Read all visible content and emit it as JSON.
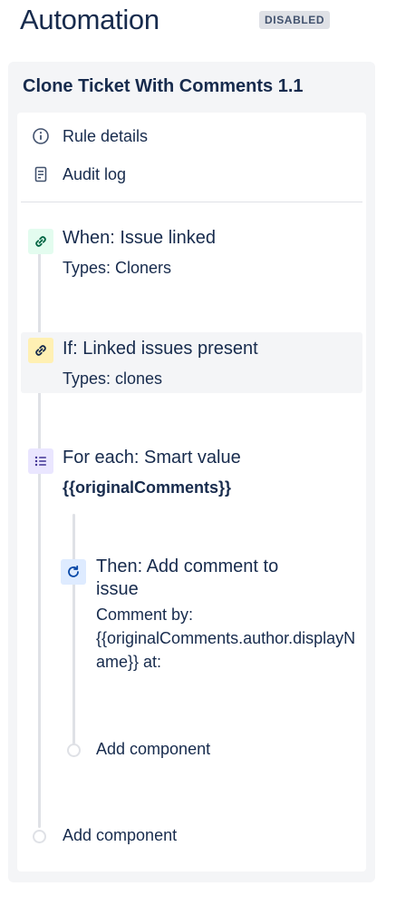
{
  "header": {
    "title": "Automation",
    "status_badge": "DISABLED"
  },
  "rule": {
    "name": "Clone Ticket With Comments 1.1",
    "menu": [
      {
        "label": "Rule details",
        "icon": "info-icon"
      },
      {
        "label": "Audit log",
        "icon": "document-icon"
      }
    ],
    "steps": [
      {
        "title": "When: Issue linked",
        "subtitle": "Types: Cloners",
        "icon": "link-icon",
        "color": "#e3fcef",
        "icon_color": "#006644"
      },
      {
        "title": "If: Linked issues present",
        "subtitle": "Types: clones",
        "icon": "link-icon",
        "color": "#fff0b3",
        "icon_color": "#172b4d"
      },
      {
        "title": "For each: Smart value",
        "subtitle": "{{originalComments}}",
        "icon": "list-icon",
        "color": "#eae6ff",
        "icon_color": "#403294"
      },
      {
        "title_line1": "Then: Add comment to",
        "title_line2": "issue",
        "subtitle_line1": "Comment by:",
        "subtitle_line2": "{{originalComments.author.displayN",
        "subtitle_line3": "ame}} at:",
        "icon": "refresh-icon",
        "color": "#deebff",
        "icon_color": "#0747a6"
      }
    ],
    "inner_add": "Add component",
    "outer_add": "Add component"
  }
}
